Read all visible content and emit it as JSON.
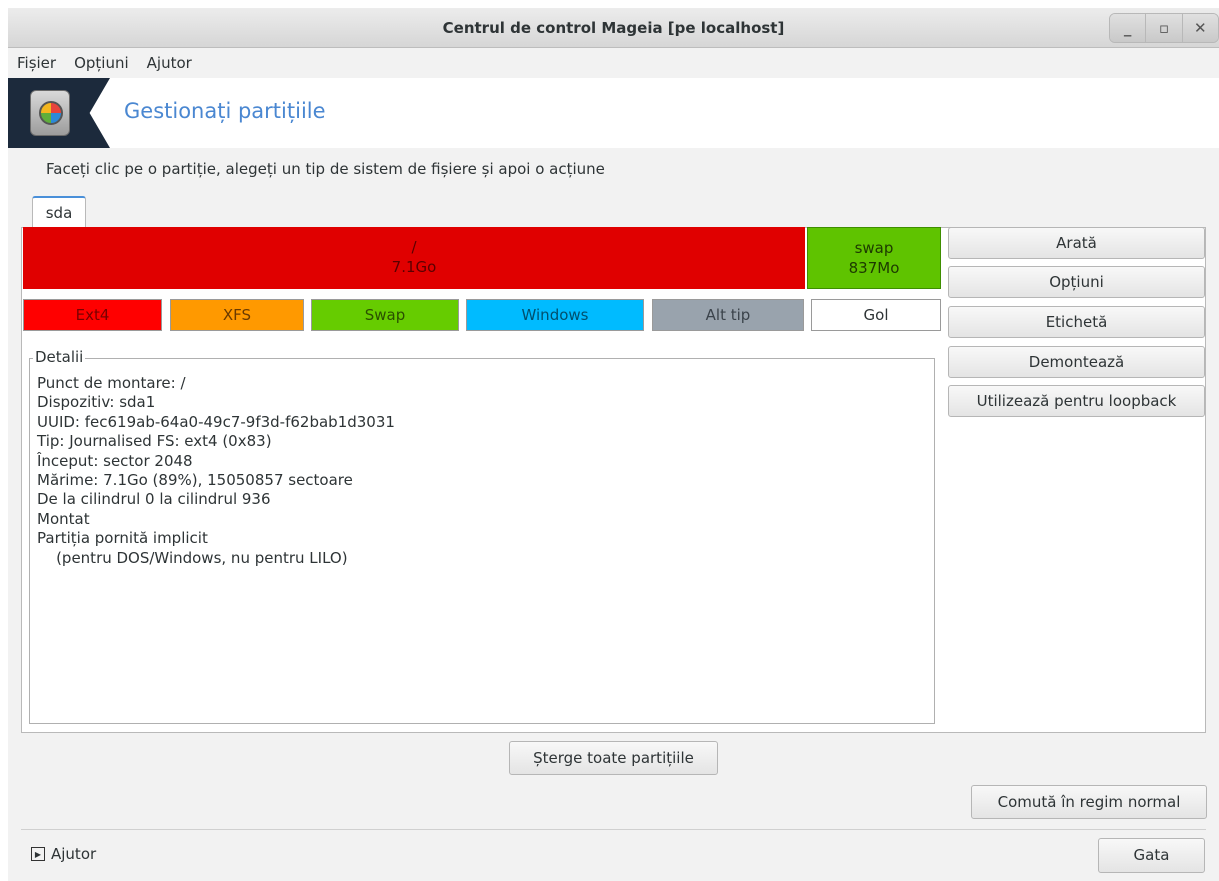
{
  "window": {
    "title": "Centrul de control Mageia  [pe localhost]",
    "buttons": {
      "minimize": "_",
      "maximize": "▫",
      "close": "✕"
    }
  },
  "menubar": {
    "items": [
      "Fișier",
      "Opțiuni",
      "Ajutor"
    ]
  },
  "header": {
    "icon": "harddisk-pie-icon",
    "title": "Gestionați partițiile"
  },
  "instruction": "Faceți clic pe o partiție, alegeți un tip de sistem de fișiere și apoi o acțiune",
  "tabs": [
    {
      "label": "sda"
    }
  ],
  "partitions": [
    {
      "mount": "/",
      "size": "7.1Go",
      "color": "#e00000"
    },
    {
      "mount": "swap",
      "size": "837Mo",
      "color": "#5fc300"
    }
  ],
  "legend": [
    {
      "label": "Ext4",
      "color": "#ff0000"
    },
    {
      "label": "XFS",
      "color": "#ff9900"
    },
    {
      "label": "Swap",
      "color": "#66cc00"
    },
    {
      "label": "Windows",
      "color": "#00bbff"
    },
    {
      "label": "Alt tip",
      "color": "#99a3ad"
    },
    {
      "label": "Gol",
      "color": "#ffffff"
    }
  ],
  "details": {
    "title": "Detalii",
    "lines": [
      "Punct de montare: /",
      "Dispozitiv: sda1",
      "UUID: fec619ab-64a0-49c7-9f3d-f62bab1d3031",
      "Tip: Journalised FS: ext4 (0x83)",
      "Început: sector 2048",
      "Mărime: 7.1Go (89%), 15050857 sectoare",
      "De la cilindrul 0 la cilindrul 936",
      "Montat",
      "Partiția pornită implicit",
      "    (pentru DOS/Windows, nu pentru LILO)"
    ]
  },
  "actions": [
    "Arată",
    "Opțiuni",
    "Etichetă",
    "Demontează",
    "Utilizează pentru loopback"
  ],
  "buttons": {
    "clear_all": "Șterge toate partițiile",
    "normal_mode": "Comută în regim normal",
    "help": "Ajutor",
    "done": "Gata"
  }
}
